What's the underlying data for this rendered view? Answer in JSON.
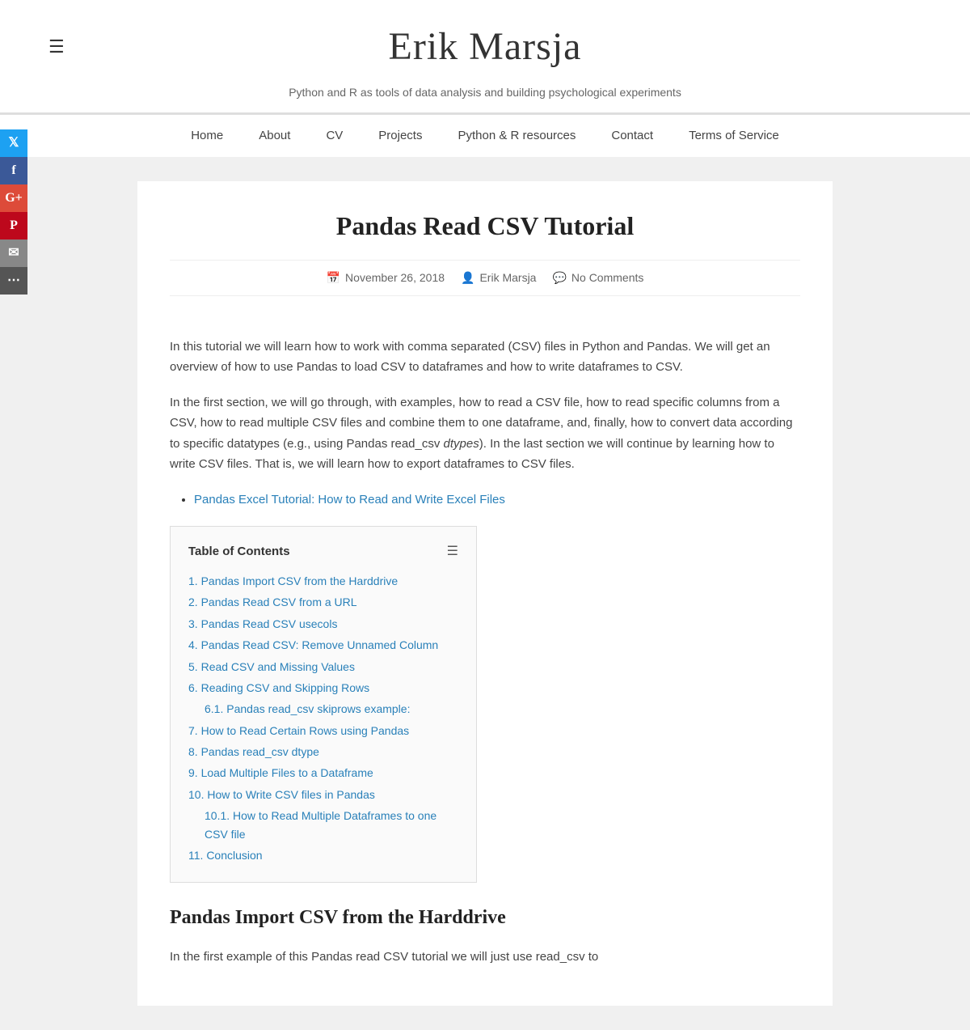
{
  "site": {
    "title": "Erik Marsja",
    "tagline": "Python and R as tools of data analysis and building psychological experiments"
  },
  "nav": {
    "items": [
      {
        "label": "Home",
        "id": "home"
      },
      {
        "label": "About",
        "id": "about"
      },
      {
        "label": "CV",
        "id": "cv"
      },
      {
        "label": "Projects",
        "id": "projects"
      },
      {
        "label": "Python & R resources",
        "id": "resources"
      },
      {
        "label": "Contact",
        "id": "contact"
      },
      {
        "label": "Terms of Service",
        "id": "terms"
      }
    ]
  },
  "social": {
    "items": [
      {
        "label": "T",
        "name": "twitter",
        "class": "twitter"
      },
      {
        "label": "f",
        "name": "facebook",
        "class": "facebook"
      },
      {
        "label": "G+",
        "name": "google",
        "class": "google"
      },
      {
        "label": "P",
        "name": "pinterest",
        "class": "pinterest"
      },
      {
        "label": "✉",
        "name": "email",
        "class": "email"
      },
      {
        "label": "•••",
        "name": "more",
        "class": "more"
      }
    ]
  },
  "article": {
    "title": "Pandas Read CSV Tutorial",
    "meta": {
      "date": "November 26, 2018",
      "author": "Erik Marsja",
      "comments": "No Comments"
    },
    "intro1": "In this tutorial we will learn how to work with comma separated (CSV) files in Python and Pandas. We will get an overview of how to use Pandas to load CSV to dataframes and how to write dataframes to CSV.",
    "intro2_part1": "In the first section, we will go through, with examples, how to read a CSV file, how to read specific columns from a CSV, how to read multiple CSV files and combine them to one dataframe, and, finally, how to convert data according to specific datatypes (e.g., using Pandas read_csv ",
    "intro2_italic": "dtypes",
    "intro2_part2": "). In the last section we will continue by learning how to write CSV files. That is, we will learn how to export dataframes to CSV files.",
    "related_link": {
      "label": "Pandas Excel Tutorial: How to Read and Write Excel Files",
      "href": "#"
    },
    "toc": {
      "title": "Table of Contents",
      "items": [
        {
          "num": "1.",
          "label": "Pandas Import CSV from the Harddrive",
          "sub": null
        },
        {
          "num": "2.",
          "label": "Pandas Read CSV from a URL",
          "sub": null
        },
        {
          "num": "3.",
          "label": "Pandas Read CSV usecols",
          "sub": null
        },
        {
          "num": "4.",
          "label": "Pandas Read CSV: Remove Unnamed Column",
          "sub": null
        },
        {
          "num": "5.",
          "label": "Read CSV and Missing Values",
          "sub": null
        },
        {
          "num": "6.",
          "label": "Reading CSV and Skipping Rows",
          "sub": [
            {
              "num": "6.1.",
              "label": "Pandas read_csv skiprows example:"
            }
          ]
        },
        {
          "num": "7.",
          "label": "How to Read Certain Rows using Pandas",
          "sub": null
        },
        {
          "num": "8.",
          "label": "Pandas read_csv dtype",
          "sub": null
        },
        {
          "num": "9.",
          "label": "Load Multiple Files to a Dataframe",
          "sub": null
        },
        {
          "num": "10.",
          "label": "How to Write CSV files in Pandas",
          "sub": [
            {
              "num": "10.1.",
              "label": "How to Read Multiple Dataframes to one CSV file"
            }
          ]
        },
        {
          "num": "11.",
          "label": "Conclusion",
          "sub": null
        }
      ]
    },
    "section1_title": "Pandas Import CSV from the Harddrive",
    "section1_intro": "In the first example of this Pandas read CSV tutorial we will just use read_csv to"
  }
}
